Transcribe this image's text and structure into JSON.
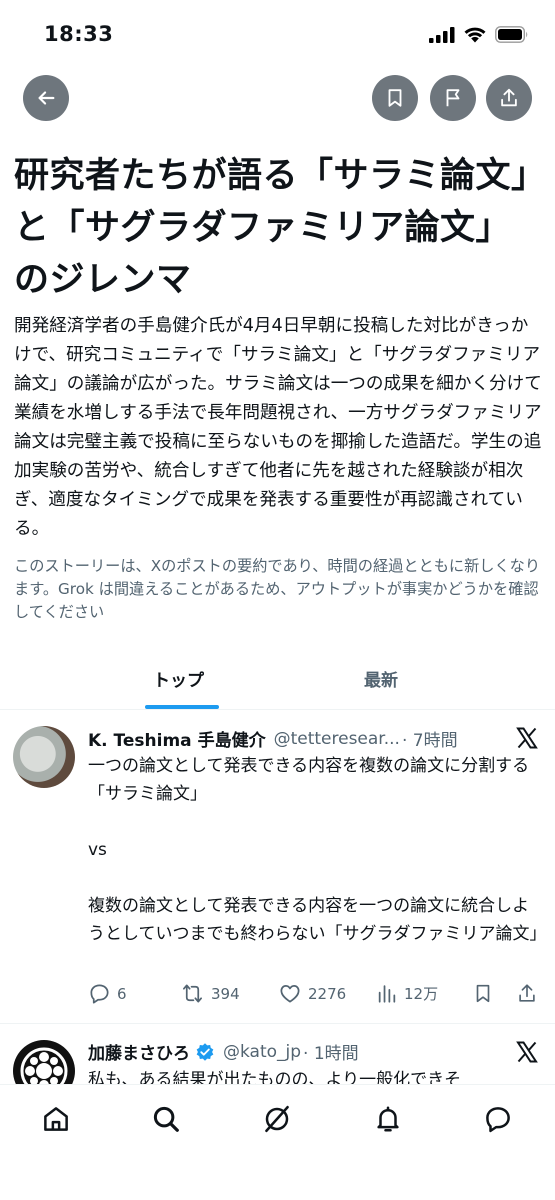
{
  "status_bar": {
    "time": "18:33"
  },
  "header": {
    "back_icon": "arrow-left-icon",
    "bookmark_icon": "bookmark-icon",
    "flag_icon": "flag-icon",
    "share_icon": "share-icon"
  },
  "article": {
    "title": "研究者たちが語る「サラミ論文」と「サグラダファミリア論文」のジレンマ",
    "summary": "開発経済学者の手島健介氏が4月4日早朝に投稿した対比がきっかけで、研究コミュニティで「サラミ論文」と「サグラダファミリア論文」の議論が広がった。サラミ論文は一つの成果を細かく分けて業績を水増しする手法で長年問題視され、一方サグラダファミリア論文は完璧主義で投稿に至らないものを揶揄した造語だ。学生の追加実験の苦労や、統合しすぎて他者に先を越された経験談が相次ぎ、適度なタイミングで成果を発表する重要性が再認識されている。",
    "disclaimer": "このストーリーは、Xのポストの要約であり、時間の経過とともに新しくなります。Grok は間違えることがあるため、アウトプットが事実かどうかを確認してください"
  },
  "tabs": [
    {
      "label": "トップ",
      "active": true
    },
    {
      "label": "最新",
      "active": false
    }
  ],
  "posts": [
    {
      "name": "K. Teshima 手島健介",
      "handle": "@tetteresear...",
      "time": "· 7時間",
      "body": "一つの論文として発表できる内容を複数の論文に分割する「サラミ論文」\n\nvs\n\n複数の論文として発表できる内容を一つの論文に統合しようとしていつまでも終わらない「サグラダファミリア論文」",
      "replies": "6",
      "reposts": "394",
      "likes": "2276",
      "views": "12万"
    },
    {
      "name": "加藤まさひろ",
      "verified": true,
      "handle": "@kato_jp",
      "time": "· 1時間",
      "body": "私も、ある結果が出たものの、より一般化できそ"
    }
  ],
  "colors": {
    "accent": "#1d9bf0",
    "secondary_text": "#536471",
    "icon_button": "#6e767d"
  }
}
